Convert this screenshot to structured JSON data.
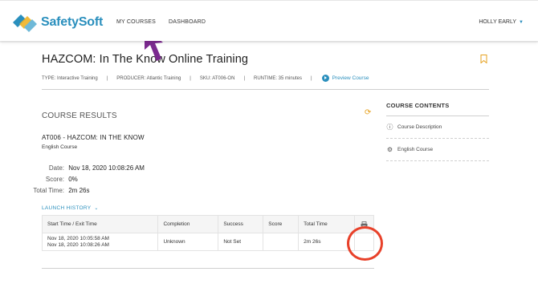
{
  "header": {
    "brand": "SafetySoft",
    "nav": {
      "courses": "MY COURSES",
      "dashboard": "DASHBOARD"
    },
    "user": "HOLLY EARLY"
  },
  "course": {
    "title": "HAZCOM: In The Know Online Training",
    "meta": {
      "type": "TYPE: Interactive Training",
      "producer": "PRODUCER: Atlantic Training",
      "sku": "SKU: AT006-ON",
      "runtime": "RUNTIME: 35 minutes",
      "preview": "Preview Course"
    }
  },
  "results": {
    "title": "COURSE RESULTS",
    "code": "AT006 - HAZCOM: IN THE KNOW",
    "subtitle": "English Course",
    "date_label": "Date:",
    "date": "Nov 18, 2020 10:08:26 AM",
    "score_label": "Score:",
    "score": "0%",
    "time_label": "Total Time:",
    "time": "2m 26s",
    "launch_history": "LAUNCH HISTORY"
  },
  "table": {
    "headers": [
      "Start Time / Exit Time",
      "Completion",
      "Success",
      "Score",
      "Total Time"
    ],
    "rows": [
      {
        "start": "Nov 18, 2020 10:05:58 AM",
        "exit": "Nov 18, 2020 10:08:26 AM",
        "completion": "Unknown",
        "success": "Not Set",
        "score": "",
        "total": "2m 26s"
      }
    ]
  },
  "sidebar": {
    "title": "COURSE CONTENTS",
    "items": [
      {
        "label": "Course Description",
        "icon": "info-icon"
      },
      {
        "label": "English Course",
        "icon": "gears-icon"
      }
    ]
  },
  "colors": {
    "brand": "#2a8fbd",
    "refresh": "#e6a11f",
    "annotation_circle": "#e8412a",
    "annotation_arrow": "#7b2a8f"
  }
}
